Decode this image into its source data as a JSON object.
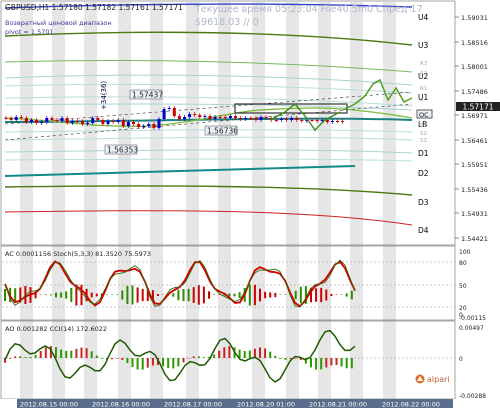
{
  "header": {
    "symbol_line": "GBPUSD,H1  1.57180 1.57182 1.57161 1.57171",
    "indicator_line1": "Возвратный ценовой диапазон",
    "indicator_line2": "pivot = 1.5701",
    "watermark_line1": "Текущее время 05:23:04 File40.5m0 Спред 17",
    "watermark_line2": "$9618.03    // 0"
  },
  "levels_labels": [
    "U4",
    "U3",
    "U2",
    "U1",
    "LB",
    "D1",
    "D2",
    "D3",
    "D4"
  ],
  "small_level_labels": [
    "R3",
    "R2",
    "R1",
    "P",
    "S1",
    "S2",
    "S3"
  ],
  "price_axis": [
    "1.59031",
    "1.58516",
    "1.58001",
    "1.57486",
    "1.56971",
    "1.56461",
    "1.55951",
    "1.55436",
    "1.54931",
    "1.54421"
  ],
  "price_tags": {
    "current": "1.57171",
    "box1": "1.57437",
    "box2": "1.56736",
    "box3": "1.56353",
    "rotated": "+34(36)",
    "oc": "OC"
  },
  "stoch_panel": {
    "title": "AC 0.0001156   Stoch(5,3,3) 81.3520 75.5973",
    "axis": [
      "100",
      "80",
      "50",
      "20",
      "0",
      "-0.00115"
    ]
  },
  "cci_panel": {
    "title": "AO 0.001282   CCI(14) 172.6022",
    "axis": [
      "0.00497",
      "0",
      "-0.00288"
    ]
  },
  "time_axis": [
    "2012.08.15 00:00",
    "2012.08.16 00:00",
    "2012.08.17 00:00",
    "2012.08.20 01:00",
    "2012.08.21 00:00",
    "2012.08.22 00:00"
  ],
  "brand": "alpari",
  "colors": {
    "price_up": "#0000cc",
    "price_down": "#cc0000",
    "fast_line": "#3c7a00",
    "teal_line": "#138a8a",
    "stoch_line": "#cc0000"
  }
}
